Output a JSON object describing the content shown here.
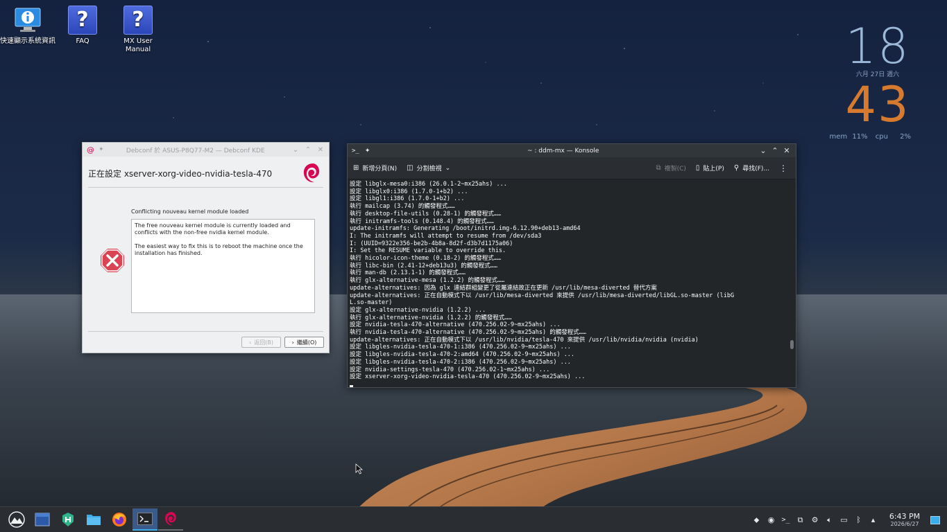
{
  "desktop": {
    "icons": [
      {
        "label": "快速顯示系統資訊"
      },
      {
        "label": "FAQ"
      },
      {
        "label": "MX User Manual"
      }
    ]
  },
  "clock_widget": {
    "hour": "18",
    "date": "六月 27日 週六",
    "minute": "43",
    "mem_label": "mem",
    "mem_value": "11%",
    "cpu_label": "cpu",
    "cpu_value": "2%"
  },
  "debconf": {
    "title": "Debconf 於 ASUS-P8Q77-M2 — Debconf KDE",
    "header": "正在設定 xserver-xorg-video-nvidia-tesla-470",
    "subtitle": "Conflicting nouveau kernel module loaded",
    "body_p1": "The free nouveau kernel module is currently loaded and conflicts with the non-free nvidia kernel module.",
    "body_p2": "The easiest way to fix this is to reboot the machine once the installation has finished.",
    "back_label": "返回(B)",
    "next_label": "繼續(O)"
  },
  "konsole": {
    "title": "~ : ddm-mx — Konsole",
    "toolbar": {
      "new_tab": "新增分頁(N)",
      "split_view": "分割檢視",
      "copy": "複製(C)",
      "paste": "貼上(P)",
      "find": "尋找(F)..."
    },
    "lines": [
      "設定 libglx-mesa0:i386 (26.0.1-2~mx25ahs) ...",
      "設定 libglx0:i386 (1.7.0-1+b2) ...",
      "設定 libgl1:i386 (1.7.0-1+b2) ...",
      "執行 mailcap (3.74) 的觸發程式……",
      "執行 desktop-file-utils (0.28-1) 的觸發程式……",
      "執行 initramfs-tools (0.148.4) 的觸發程式……",
      "update-initramfs: Generating /boot/initrd.img-6.12.90+deb13-amd64",
      "I: The initramfs will attempt to resume from /dev/sda3",
      "I: (UUID=9322e356-be2b-4b8a-8d2f-d3b7d1175a06)",
      "I: Set the RESUME variable to override this.",
      "執行 hicolor-icon-theme (0.18-2) 的觸發程式……",
      "執行 libc-bin (2.41-12+deb13u3) 的觸發程式……",
      "執行 man-db (2.13.1-1) 的觸發程式……",
      "執行 glx-alternative-mesa (1.2.2) 的觸發程式……",
      "update-alternatives: 因為 glx 連結群組變更了從屬連結故正在更新 /usr/lib/mesa-diverted 替代方案",
      "update-alternatives: 正在自動模式下以 /usr/lib/mesa-diverted 來提供 /usr/lib/mesa-diverted/libGL.so-master (libG",
      "L.so-master)",
      "設定 glx-alternative-nvidia (1.2.2) ...",
      "執行 glx-alternative-nvidia (1.2.2) 的觸發程式……",
      "設定 nvidia-tesla-470-alternative (470.256.02-9~mx25ahs) ...",
      "執行 nvidia-tesla-470-alternative (470.256.02-9~mx25ahs) 的觸發程式……",
      "update-alternatives: 正在自動模式下以 /usr/lib/nvidia/tesla-470 來提供 /usr/lib/nvidia/nvidia (nvidia)",
      "設定 libgles-nvidia-tesla-470-1:i386 (470.256.02-9~mx25ahs) ...",
      "設定 libgles-nvidia-tesla-470-2:amd64 (470.256.02-9~mx25ahs) ...",
      "設定 libgles-nvidia-tesla-470-2:i386 (470.256.02-9~mx25ahs) ...",
      "設定 nvidia-settings-tesla-470 (470.256.02-1~mx25ahs) ...",
      "設定 xserver-xorg-video-nvidia-tesla-470 (470.256.02-9~mx25ahs) ..."
    ]
  },
  "taskbar": {
    "time": "6:43 PM",
    "date": "2026/6/27"
  }
}
